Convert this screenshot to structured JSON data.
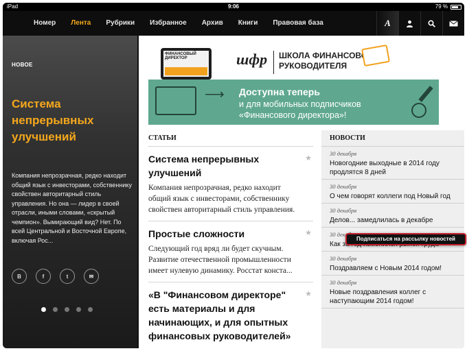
{
  "status_bar": {
    "carrier": "iPad",
    "time": "9:06",
    "battery": "79 %",
    "battery_level": 0.79
  },
  "nav": {
    "items": [
      {
        "label": "Номер",
        "active": false
      },
      {
        "label": "Лента",
        "active": true
      },
      {
        "label": "Рубрики",
        "active": false
      },
      {
        "label": "Избранное",
        "active": false
      },
      {
        "label": "Архив",
        "active": false
      },
      {
        "label": "Книги",
        "active": false
      },
      {
        "label": "Правовая база",
        "active": false
      }
    ],
    "font_button": "A",
    "icons": [
      "font-size-icon",
      "user-icon",
      "search-icon",
      "mail-icon"
    ]
  },
  "feature": {
    "tag": "НОВОЕ",
    "title": "Система непрерывных улучшений",
    "text": "Компания непрозрачная, редко находит общий язык с инвесторами, собственнику свойствен авторитарный стиль управления. Но она — лидер в своей отрасли, иными словами, «скрытый чемпион». Вымирающий вид? Нет. По всей Центральной и Восточной Европе, включая Рос...",
    "social": [
      {
        "icon": "vkontakte-icon",
        "glyph": "B"
      },
      {
        "icon": "facebook-icon",
        "glyph": "f"
      },
      {
        "icon": "twitter-icon",
        "glyph": "t"
      },
      {
        "icon": "email-icon",
        "glyph": "✉"
      }
    ],
    "pager": {
      "count": 5,
      "active_index": 0
    }
  },
  "banners": {
    "school": {
      "magazine": "ФИНАНСОВЫЙ ДИРЕКТОР",
      "logo": "шфр",
      "name_line1": "ШКОЛА ФИНАНСОВОГО",
      "name_line2": "РУКОВОДИТЕЛЯ"
    },
    "mobile": {
      "line1": "Доступна теперь",
      "line2": "и для мобильных подписчиков «Финансового директора»!"
    }
  },
  "articles": {
    "heading": "СТАТЬИ",
    "items": [
      {
        "title": "Система непрерывных улучшений",
        "lead": "Компания непрозрачная, редко находит общий язык с инвесторами, собственнику свойствен авторитарный стиль управления."
      },
      {
        "title": "Простые сложности",
        "lead": "Следующий год вряд ли будет скучным. Развитие отечественной промышленности имеет нулевую динамику. Росстат конста..."
      },
      {
        "title": "«В \"Финансовом директоре\" есть материалы и для начинающих, и для опытных финансовых руководителей»",
        "lead": ""
      }
    ]
  },
  "news": {
    "heading": "НОВОСТИ",
    "items": [
      {
        "date": "30 декабря",
        "headline": "Новогодние выходные в 2014 году продлятся 8 дней"
      },
      {
        "date": "30 декабря",
        "headline": "О чем говорят коллеги под Новый год"
      },
      {
        "date": "30 декабря",
        "headline": "Делов... замедлилась в декабре"
      },
      {
        "date": "30 декабря",
        "headline": "Как за год изменился рынок труда"
      },
      {
        "date": "30 декабря",
        "headline": "Поздравляем с Новым 2014 годом!"
      },
      {
        "date": "30 декабря",
        "headline": "Новые поздравления коллег с наступающим 2014 годом!"
      }
    ]
  },
  "subscribe_button": "Подписаться на рассылку новостей",
  "colors": {
    "accent": "#f5a81c",
    "nav_bg": "#0e0e0e",
    "banner_green": "#5fa88f",
    "news_bg": "#efefef",
    "subscribe_border": "#c3202a"
  }
}
